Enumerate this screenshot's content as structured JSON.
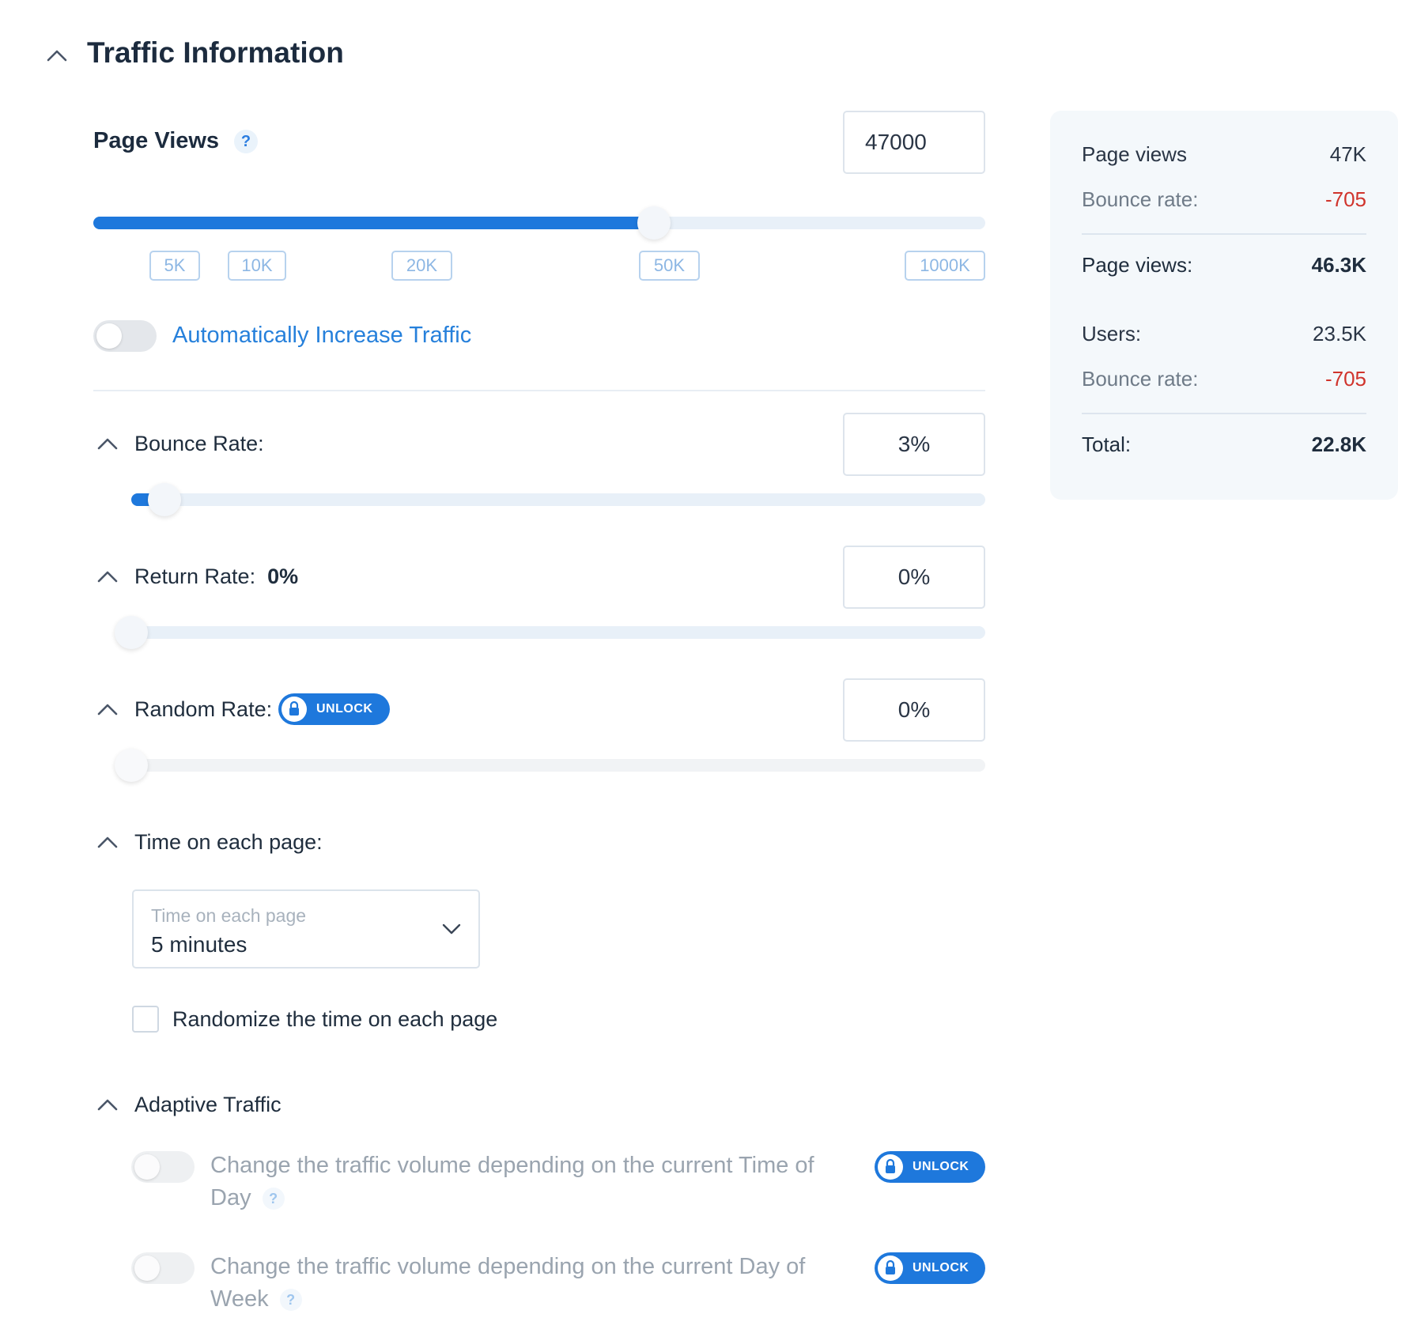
{
  "section": {
    "title": "Traffic Information"
  },
  "page_views": {
    "label": "Page Views",
    "help": "?",
    "value": "47000",
    "slider_fraction": 0.62,
    "ticks": [
      "5K",
      "10K",
      "20K",
      "50K",
      "1000K"
    ]
  },
  "auto_increase": {
    "label": "Automatically Increase Traffic",
    "enabled": false
  },
  "bounce_rate": {
    "label": "Bounce Rate:",
    "value": "3%",
    "slider_fraction": 0.03
  },
  "return_rate": {
    "label": "Return Rate:",
    "inline_value": "0%",
    "value": "0%",
    "slider_fraction": 0
  },
  "random_rate": {
    "label": "Random Rate:",
    "unlock": "UNLOCK",
    "value": "0%",
    "slider_fraction": 0
  },
  "time_on_page": {
    "label": "Time on each page:",
    "select_placeholder": "Time on each page",
    "select_value": "5 minutes",
    "randomize_label": "Randomize the time on each page",
    "randomize_checked": false
  },
  "adaptive": {
    "label": "Adaptive Traffic",
    "items": [
      {
        "text": "Change the traffic volume depending on the current Time of Day",
        "help": "?",
        "unlock": "UNLOCK",
        "enabled": false
      },
      {
        "text": "Change the traffic volume depending on the current Day of Week",
        "help": "?",
        "unlock": "UNLOCK",
        "enabled": false
      }
    ]
  },
  "summary": {
    "rows_a": [
      {
        "label": "Page views",
        "value": "47K"
      },
      {
        "label": "Bounce rate:",
        "value": "-705"
      }
    ],
    "page_views_total": {
      "label": "Page views:",
      "value": "46.3K"
    },
    "rows_b": [
      {
        "label": "Users:",
        "value": "23.5K"
      },
      {
        "label": "Bounce rate:",
        "value": "-705"
      }
    ],
    "total": {
      "label": "Total:",
      "value": "22.8K"
    }
  },
  "colors": {
    "accent": "#1e78dc",
    "negative": "#d0342c",
    "muted_label": "#6f7b88"
  }
}
